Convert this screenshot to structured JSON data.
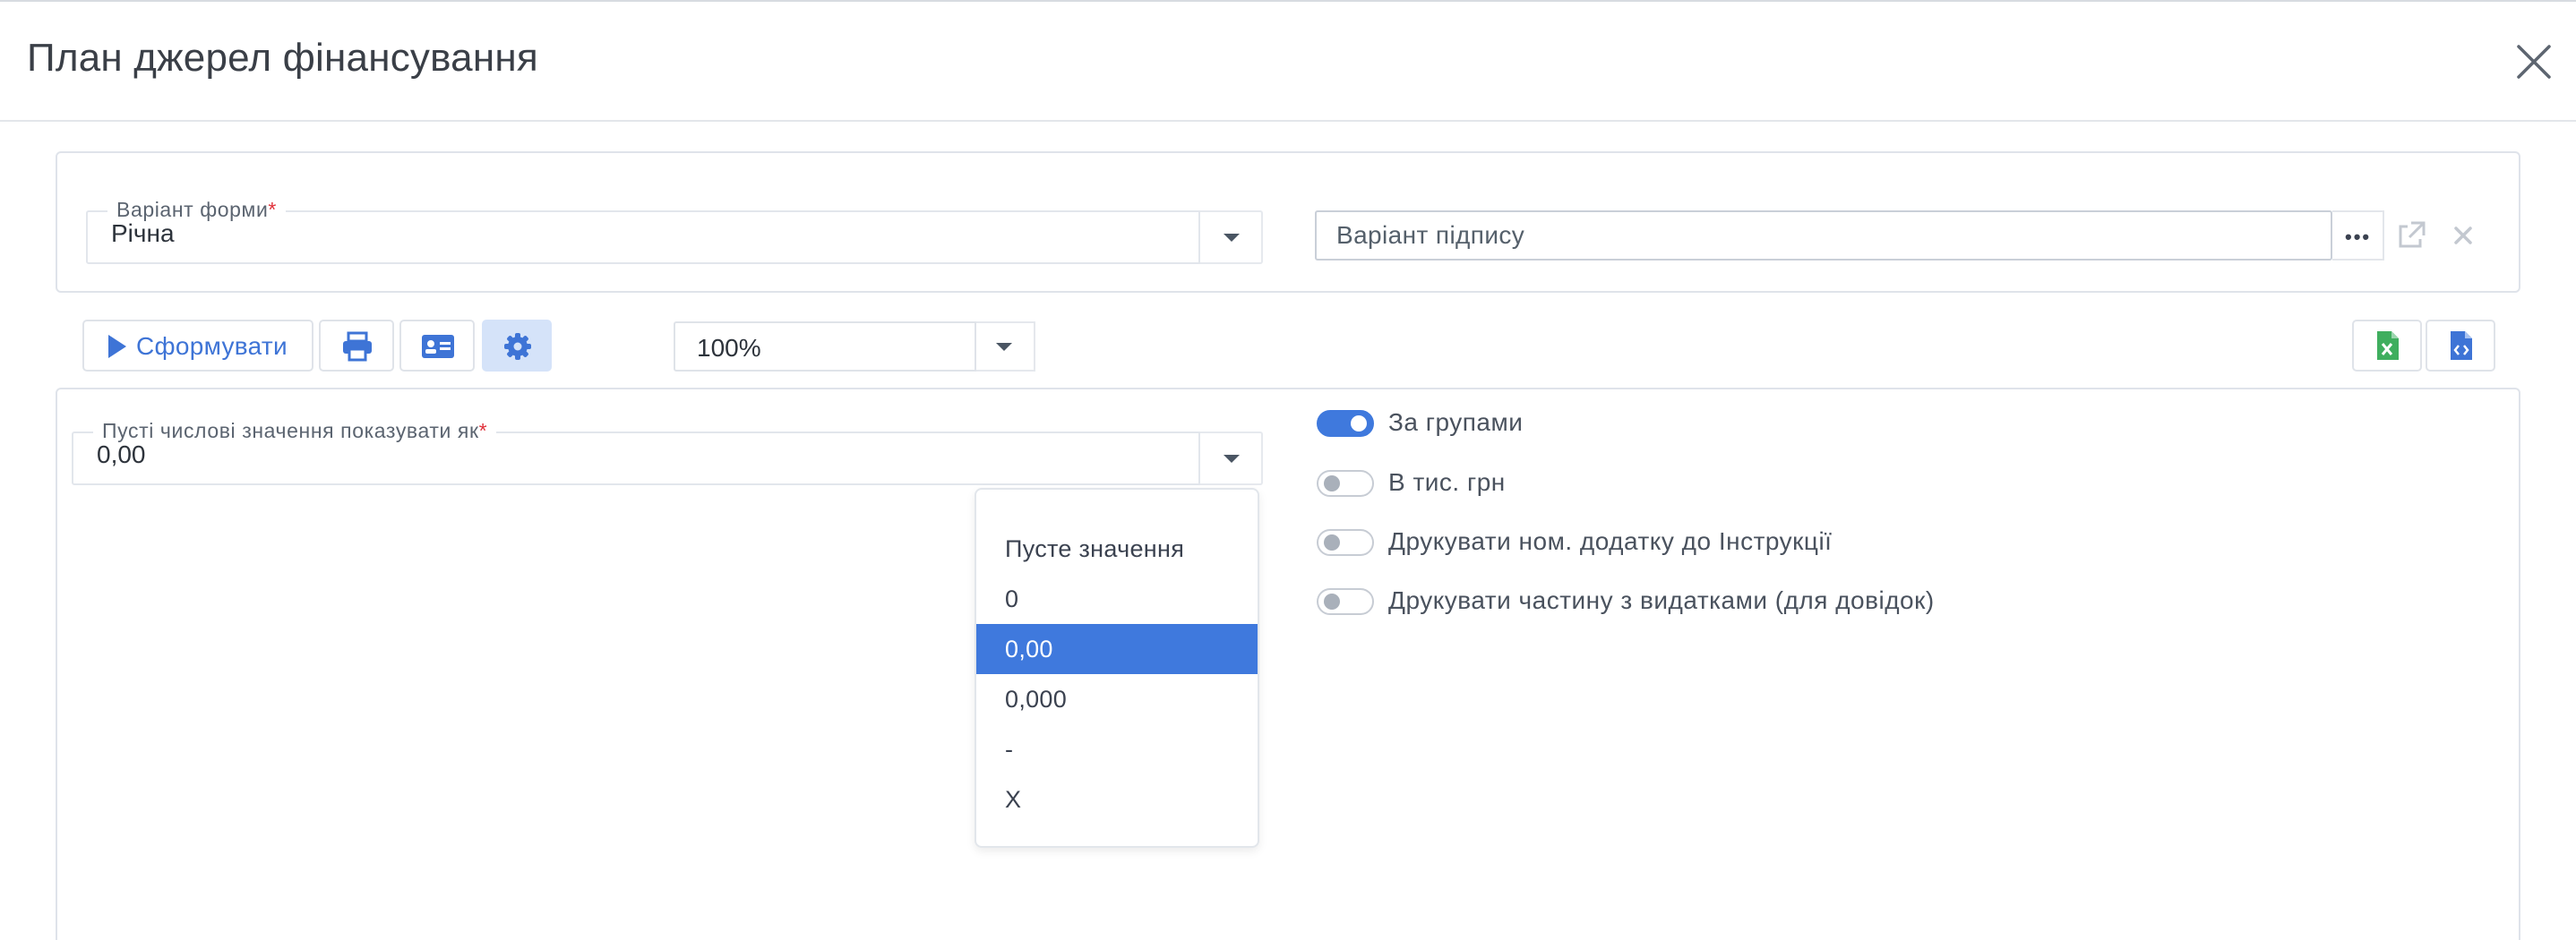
{
  "dialog": {
    "title": "План джерел фінансування"
  },
  "form": {
    "variant_label": "Варіант форми",
    "required_mark": "*",
    "variant_value": "Річна",
    "signature_placeholder": "Варіант підпису"
  },
  "toolbar": {
    "generate_label": "Сформувати",
    "zoom_value": "100%"
  },
  "settings": {
    "empty_values_label": "Пусті числові значення показувати як",
    "empty_values_value": "0,00",
    "dropdown_options": [
      "Пусте значення",
      "0",
      "0,00",
      "0,000",
      "-",
      "X"
    ],
    "dropdown_selected": "0,00",
    "toggles": [
      {
        "label": "За групами",
        "on": true
      },
      {
        "label": "В тис. грн",
        "on": false
      },
      {
        "label": "Друкувати ном. додатку до Інструкції",
        "on": false
      },
      {
        "label": "Друкувати частину з видатками (для довідок)",
        "on": false
      }
    ]
  },
  "colors": {
    "accent": "#3f79dd",
    "required": "#e0313a",
    "excel_green": "#3fae5e",
    "gear_bg": "#d5e3f9"
  },
  "icons": [
    "close-icon",
    "chevron-down-icon",
    "more-dots-icon",
    "open-external-icon",
    "clear-icon",
    "play-icon",
    "print-icon",
    "id-card-icon",
    "gear-icon",
    "excel-file-icon",
    "code-file-icon"
  ]
}
